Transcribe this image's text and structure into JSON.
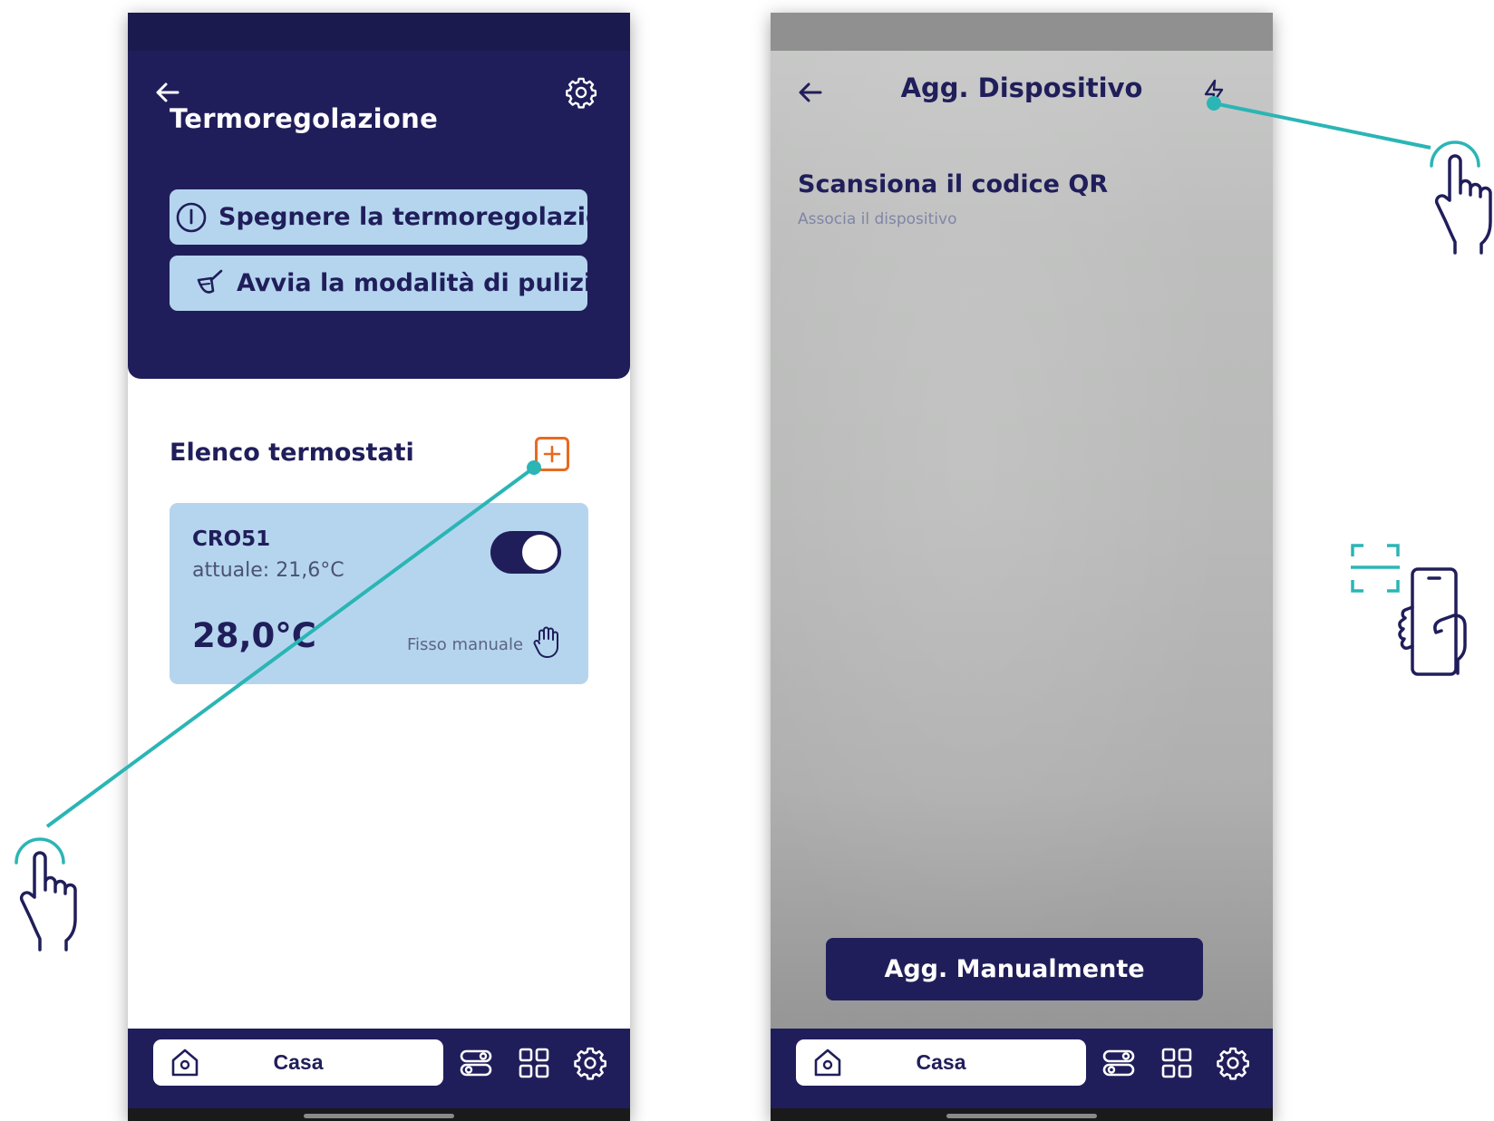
{
  "colors": {
    "navy": "#201e5a",
    "light_blue": "#b5d5ef",
    "accent_orange": "#e86a1e",
    "annotation_teal": "#2bb5b5"
  },
  "screen1": {
    "back_icon": "arrow-left-icon",
    "settings_icon": "gear-icon",
    "title": "Termoregolazione",
    "turn_off_button": {
      "icon": "power-icon",
      "label": "Spegnere la termoregolazione"
    },
    "cleaning_button": {
      "icon": "broom-icon",
      "label": "Avvia la modalità di pulizia"
    },
    "thermostat_list": {
      "title": "Elenco termostati",
      "add_icon": "plus-square-icon",
      "items": [
        {
          "name": "CRO51",
          "current": "attuale: 21,6°C",
          "setpoint": "28,0°C",
          "mode": "Fisso manuale",
          "mode_icon": "hand-icon",
          "enabled": true
        }
      ]
    },
    "nav": {
      "home_label": "Casa",
      "icons": [
        "home-icon",
        "toggles-icon",
        "grid-icon",
        "gear-icon"
      ]
    }
  },
  "screen2": {
    "back_icon": "arrow-left-icon",
    "title": "Agg. Dispositivo",
    "flash_icon": "flash-icon",
    "qr_title": "Scansiona il codice QR",
    "qr_subtitle": "Associa il dispositivo",
    "manual_button": "Agg. Manualmente",
    "nav": {
      "home_label": "Casa",
      "icons": [
        "home-icon",
        "toggles-icon",
        "grid-icon",
        "gear-icon"
      ]
    }
  }
}
